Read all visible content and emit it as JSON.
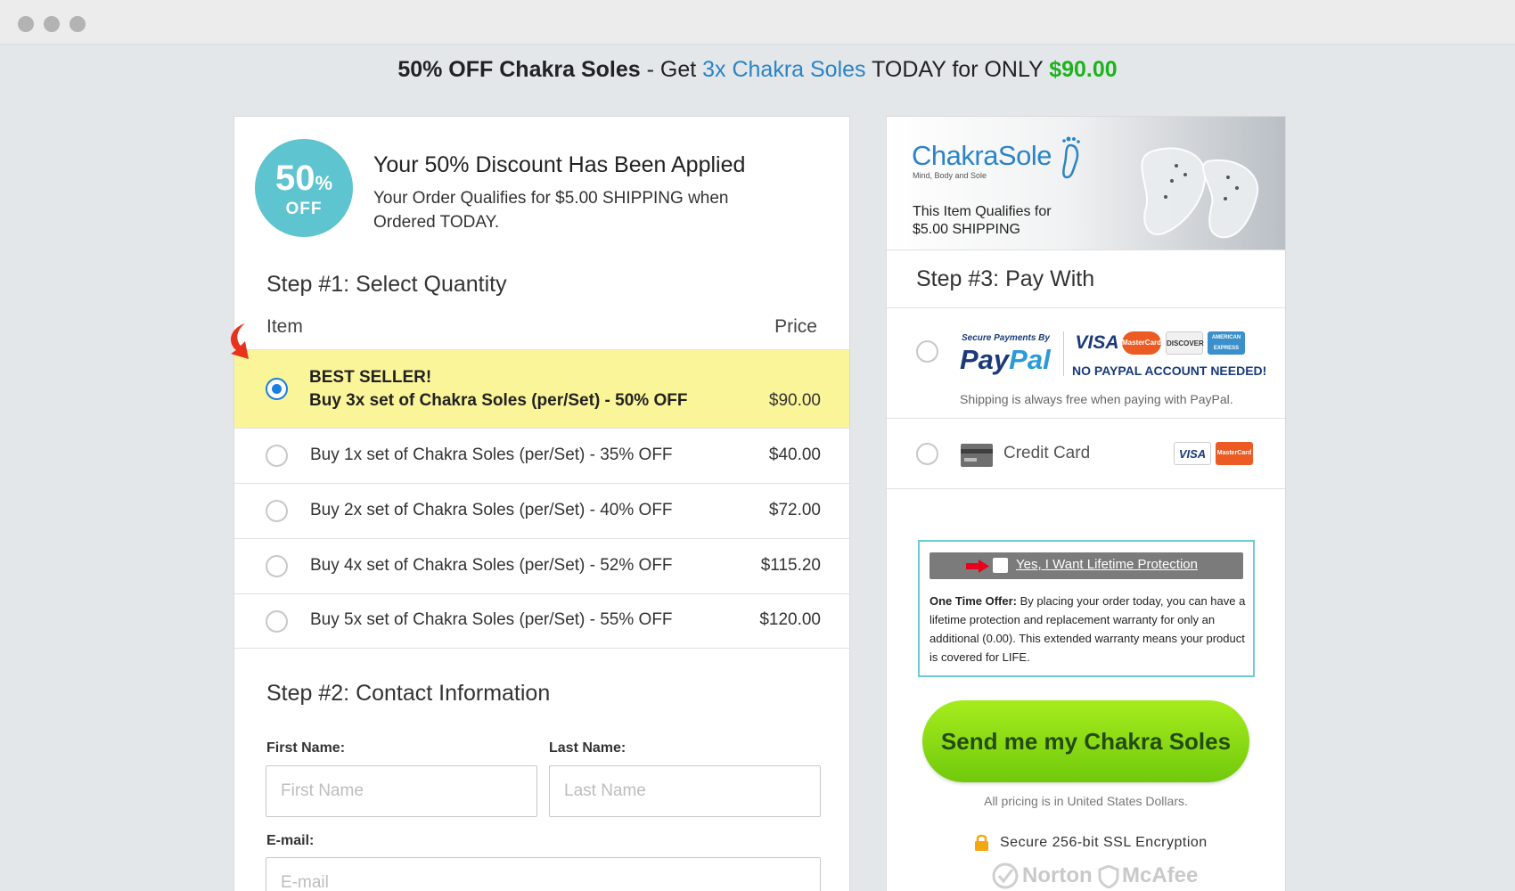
{
  "headline": {
    "part1": "50% OFF Chakra Soles",
    "part2": " - Get ",
    "part3": "3x Chakra Soles",
    "part4": " TODAY for ONLY ",
    "part5": "$90.00"
  },
  "discount": {
    "badge_pct": "50",
    "badge_pct_sign": "%",
    "badge_off": "OFF",
    "title": "Your 50% Discount Has Been Applied",
    "subtitle": "Your Order Qualifies for $5.00 SHIPPING when Ordered TODAY."
  },
  "step1": {
    "title": "Step #1: Select Quantity",
    "col_item": "Item",
    "col_price": "Price",
    "best_label": "BEST SELLER!",
    "best_item": "Buy 3x set of Chakra Soles (per/Set) - 50% OFF",
    "best_price": "$90.00",
    "options": [
      {
        "label": "Buy 1x set of Chakra Soles (per/Set) - 35% OFF",
        "price": "$40.00"
      },
      {
        "label": "Buy 2x set of Chakra Soles (per/Set) - 40% OFF",
        "price": "$72.00"
      },
      {
        "label": "Buy 4x set of Chakra Soles (per/Set) - 52% OFF",
        "price": "$115.20"
      },
      {
        "label": "Buy 5x set of Chakra Soles (per/Set) - 55% OFF",
        "price": "$120.00"
      }
    ]
  },
  "step2": {
    "title": "Step #2: Contact Information",
    "first_label": "First Name:",
    "first_placeholder": "First Name",
    "last_label": "Last Name:",
    "last_placeholder": "Last Name",
    "email_label": "E-mail:",
    "email_placeholder": "E-mail"
  },
  "banner": {
    "logo": "ChakraSole",
    "logo_sub": "Mind, Body and Sole",
    "text": "This Item Qualifies for $5.00 SHIPPING"
  },
  "step3": {
    "title": "Step #3: Pay With",
    "paypal_secure": "Secure Payments By",
    "paypal_pay": "Pay",
    "paypal_pal": "Pal",
    "no_account": "NO PAYPAL ACCOUNT  NEEDED!",
    "shipping_note": "Shipping is always free when paying with PayPal.",
    "credit_card": "Credit Card",
    "cards": {
      "visa": "VISA",
      "mastercard": "MasterCard",
      "discover": "DISCOVER",
      "amex": "AMERICAN EXPRESS"
    }
  },
  "offer": {
    "checkbox_label": "Yes, I Want Lifetime Protection",
    "lead": "One Time Offer:",
    "text": " By placing your order today, you can have a lifetime protection and replacement warranty for only an additional (0.00). This extended warranty means your product is covered for LIFE."
  },
  "cta": {
    "button": "Send me my Chakra Soles",
    "pricing_note": "All pricing is in United States Dollars.",
    "ssl": "Secure 256-bit SSL Encryption",
    "seal_norton": "Norton",
    "seal_mcafee": "McAfee"
  },
  "colors": {
    "accent_blue": "#2a84c6",
    "price_green": "#1db31d",
    "selected_row": "#fbf59a",
    "cta_green": "#8fdc16"
  }
}
